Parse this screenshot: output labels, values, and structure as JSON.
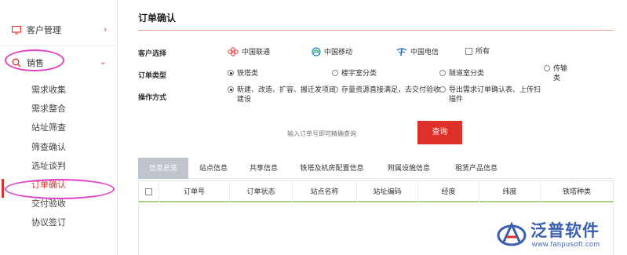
{
  "sidebar": {
    "customer_group": "客户管理",
    "sales_group": "销售",
    "items": [
      {
        "label": "需求收集"
      },
      {
        "label": "需求整合"
      },
      {
        "label": "站址筛查"
      },
      {
        "label": "筛查确认"
      },
      {
        "label": "选址谈判"
      },
      {
        "label": "订单确认"
      },
      {
        "label": "交付验收"
      },
      {
        "label": "协议签订"
      }
    ],
    "active_item": "订单确认",
    "accent_color": "#e0302a",
    "highlight_color": "#e040c8"
  },
  "page": {
    "title": "订单确认"
  },
  "filters": {
    "customer_label": "客户选择",
    "carriers": [
      {
        "name": "中国联通",
        "icon": "china-unicom-logo"
      },
      {
        "name": "中国移动",
        "icon": "china-mobile-logo"
      },
      {
        "name": "中国电信",
        "icon": "china-telecom-logo"
      }
    ],
    "all_label": "所有",
    "order_type_label": "订单类型",
    "order_types": [
      {
        "label": "铁塔类",
        "selected": true
      },
      {
        "label": "楼宇室分类",
        "selected": false
      },
      {
        "label": "隧道室分类",
        "selected": false
      },
      {
        "label": "传输类",
        "selected": false
      }
    ],
    "operation_label": "操作方式",
    "operations": [
      {
        "label": "新建、改造、扩容、搬迁发项目建设",
        "selected": true
      },
      {
        "label": "存量资源直接满足，去交付验收",
        "selected": false
      },
      {
        "label": "导出需求订单确认表、上传扫描件",
        "selected": false
      }
    ]
  },
  "search": {
    "placeholder": "输入订单号即可精确查询",
    "button_label": "查询"
  },
  "tabs": [
    {
      "label": "信息总览",
      "active": true
    },
    {
      "label": "站点信息",
      "active": false
    },
    {
      "label": "共享信息",
      "active": false
    },
    {
      "label": "铁塔及机房配置信息",
      "active": false
    },
    {
      "label": "附属设施信息",
      "active": false
    },
    {
      "label": "租赁产品信息",
      "active": false
    }
  ],
  "table": {
    "columns": [
      "订单号",
      "订单状态",
      "站点名称",
      "站址编码",
      "经度",
      "纬度",
      "铁塔种类"
    ]
  },
  "logo": {
    "name": "泛普软件",
    "url": "www.fanpusoft.com"
  }
}
